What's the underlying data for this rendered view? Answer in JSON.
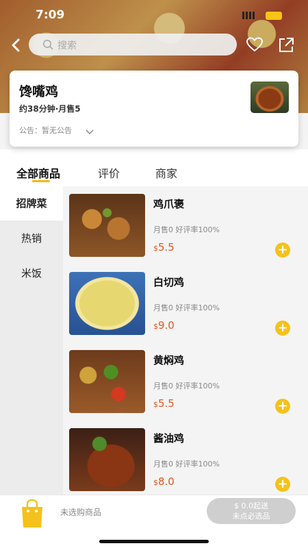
{
  "status": {
    "time": "7:09"
  },
  "search": {
    "placeholder": "搜索"
  },
  "store": {
    "name": "馋嘴鸡",
    "meta": "约38分钟·月售5",
    "notice": "公告：暂无公告"
  },
  "tabs": [
    "全部商品",
    "评价",
    "商家"
  ],
  "categories": [
    "招牌菜",
    "热销",
    "米饭"
  ],
  "products": [
    {
      "name": "鸡爪褒",
      "stats": "月售0   好评率100%",
      "currency": "$",
      "price": "5.5"
    },
    {
      "name": "白切鸡",
      "stats": "月售0   好评率100%",
      "currency": "$",
      "price": "9.0"
    },
    {
      "name": "黄焖鸡",
      "stats": "月售0   好评率100%",
      "currency": "$",
      "price": "5.5"
    },
    {
      "name": "酱油鸡",
      "stats": "月售0   好评率100%",
      "currency": "$",
      "price": "8.0"
    }
  ],
  "cart": {
    "empty_text": "未选购商品",
    "min_order": "$ 0.0起送",
    "required_note": "未点必选品"
  },
  "colors": {
    "accent": "#f5c21b",
    "price": "#e2561f"
  }
}
